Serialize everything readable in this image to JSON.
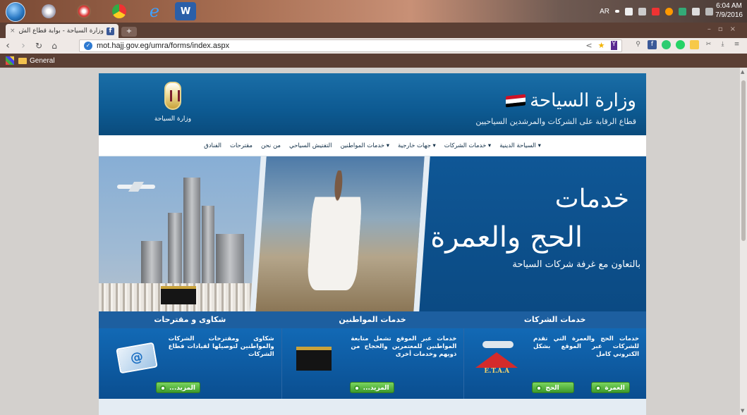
{
  "taskbar": {
    "apps": [
      "start",
      "media-player",
      "app-s",
      "chrome",
      "internet-explorer",
      "word"
    ],
    "word_label": "W",
    "language": "AR",
    "clock_time": "6:04 AM",
    "clock_date": "7/9/2016"
  },
  "browser": {
    "tab_title": "وزارة السياحة - بوابة قطاع الش",
    "tab_favicon": "f",
    "tab_close": "×",
    "new_tab": "+",
    "url": "mot.hajj.gov.eg/umra/forms/index.aspx",
    "bookmark_folder": "General"
  },
  "site": {
    "logo_text": "وزارة السياحة",
    "title": "وزارة السياحة",
    "subtitle": "قطاع الرقابة على الشركات والمرشدين السياحيين",
    "nav": [
      "▾ السياحة الدينية",
      "▾ خدمات الشركات",
      "▾ جهات خارجية",
      "▾ خدمات المواطنين",
      "التفتيش السياحي",
      "من نحن",
      "مقترحات",
      "الفنادق"
    ],
    "banner": {
      "word1": "خدمات",
      "word2": "الحج والعمرة",
      "sub": "بالتعاون مع غرفة شركات السياحة"
    },
    "sections": [
      "خدمات الشركات",
      "خدمات المواطنين",
      "شكاوى و مقترحات"
    ],
    "cards": [
      {
        "text": "خدمات الحج والعمرة التي تقدم للشركات عبر الموقع بشكل الكتروني كامل",
        "logo_text": "E.T.A.A",
        "buttons": [
          "العمرة",
          "الحج"
        ]
      },
      {
        "text": "خدمات عبر الموقع تشمل متابعة المواطنين للمعتمرين والحجاج من ذويهم وخدمات أخرى",
        "buttons": [
          "المزيد..."
        ]
      },
      {
        "text": "شكاوى ومقترحات الشركات والمواطنين لتوصيلها لقيادات قطاع الشركات",
        "buttons": [
          "المزيد..."
        ]
      }
    ]
  },
  "colors": {
    "header_blue": "#0d5a92",
    "nav_bg": "#ffffff",
    "card_blue": "#1269b5",
    "button_green": "#3d9a2b",
    "flag_red": "#ce1126",
    "flag_white": "#ffffff",
    "flag_black": "#000000"
  }
}
